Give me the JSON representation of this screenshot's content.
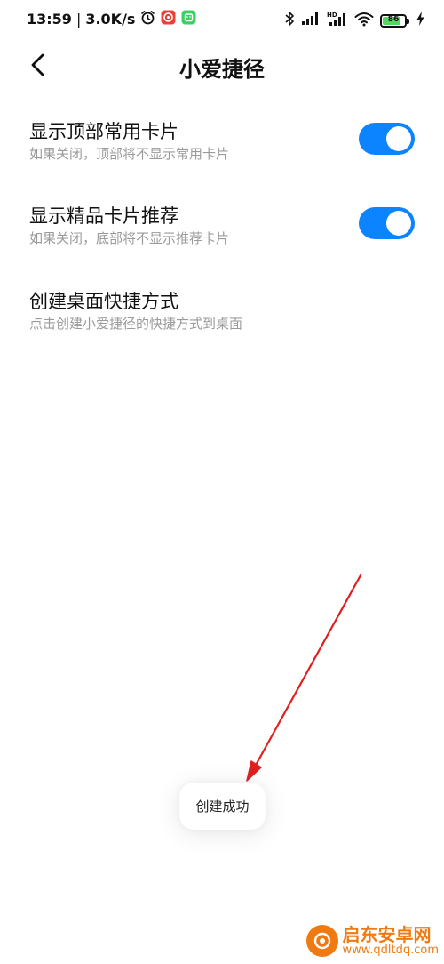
{
  "status_bar": {
    "time": "13:59",
    "separator": "|",
    "net_speed": "3.0K/s",
    "battery_level": "86",
    "battery_percent": 86,
    "icons": [
      "alarm-icon",
      "app-notification-icon",
      "android-notification-icon",
      "bluetooth-icon",
      "signal-icon",
      "hd-signal-icon",
      "wifi-icon",
      "battery-icon",
      "charging-icon"
    ]
  },
  "header": {
    "back_icon": "chevron-left-icon",
    "title": "小爱捷径"
  },
  "settings": [
    {
      "title": "显示顶部常用卡片",
      "desc": "如果关闭，顶部将不显示常用卡片",
      "toggle_on": true
    },
    {
      "title": "显示精品卡片推荐",
      "desc": "如果关闭，底部将不显示推荐卡片",
      "toggle_on": true
    },
    {
      "title": "创建桌面快捷方式",
      "desc": "点击创建小爱捷径的快捷方式到桌面"
    }
  ],
  "toast": {
    "text": "创建成功"
  },
  "colors": {
    "accent": "#0d84ff",
    "desc_gray": "#9b9b9b",
    "annotation_red": "#e02020",
    "watermark_orange": "#f07a12"
  },
  "watermark": {
    "title": "启东安卓网",
    "url": "www.qdltdq.com"
  }
}
